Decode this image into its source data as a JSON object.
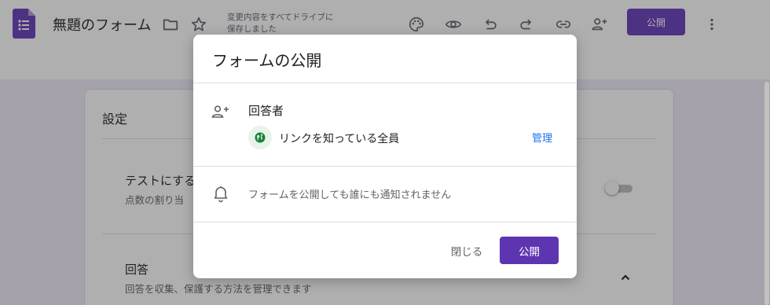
{
  "header": {
    "form_title": "無題のフォーム",
    "save_status_line1": "変更内容をすべてドライブに",
    "save_status_line2": "保存しました",
    "publish_label": "公開",
    "accent_color": "#673ab7",
    "icons": [
      "forms-logo-icon",
      "folder-icon",
      "star-icon",
      "palette-icon",
      "preview-eye-icon",
      "undo-icon",
      "redo-icon",
      "link-icon",
      "add-collaborator-icon",
      "more-vert-icon"
    ]
  },
  "settings": {
    "title": "設定",
    "quiz": {
      "title": "テストにする",
      "subtitle": "点数の割り当",
      "enabled": false
    },
    "responses": {
      "title": "回答",
      "subtitle": "回答を収集、保護する方法を管理できます",
      "expanded": true
    }
  },
  "dialog": {
    "title": "フォームの公開",
    "responders_label": "回答者",
    "access_label": "リンクを知っている全員",
    "manage_label": "管理",
    "notify_text": "フォームを公開しても誰にも通知されません",
    "close_label": "閉じる",
    "publish_label": "公開",
    "publish_color": "#5e35b1",
    "link_color": "#1a73e8"
  }
}
